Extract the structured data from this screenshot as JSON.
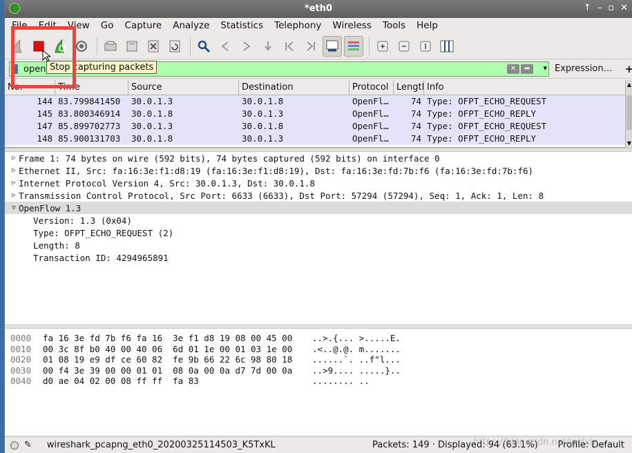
{
  "window": {
    "title": "*eth0",
    "controls": [
      "↑",
      "–",
      "▫",
      "✕"
    ]
  },
  "menu": [
    {
      "label": "File"
    },
    {
      "label": "Edit"
    },
    {
      "label": "View"
    },
    {
      "label": "Go"
    },
    {
      "label": "Capture"
    },
    {
      "label": "Analyze"
    },
    {
      "label": "Statistics"
    },
    {
      "label": "Telephony"
    },
    {
      "label": "Wireless"
    },
    {
      "label": "Tools"
    },
    {
      "label": "Help"
    }
  ],
  "toolbar": {
    "tooltip": "Stop capturing packets",
    "icons": [
      "shark-fin-icon",
      "stop-capture-icon",
      "restart-capture-icon",
      "capture-options-icon",
      "open-file-icon",
      "save-file-icon",
      "close-file-icon",
      "reload-icon",
      "find-packet-icon",
      "go-back-icon",
      "go-forward-icon",
      "go-to-packet-icon",
      "first-packet-icon",
      "last-packet-icon",
      "auto-scroll-icon",
      "colorize-icon",
      "zoom-in-icon",
      "zoom-out-icon",
      "normal-size-icon",
      "resize-columns-icon"
    ]
  },
  "filter": {
    "value": "openf",
    "expression_label": "Expression…",
    "add_label": "+",
    "color": "#afffaf"
  },
  "packet_list": {
    "columns": [
      "No.",
      "Time",
      "Source",
      "Destination",
      "Protocol",
      "Length",
      "Info"
    ],
    "rows": [
      {
        "no": "144",
        "time": "83.799841450",
        "src": "30.0.1.3",
        "dst": "30.0.1.8",
        "proto": "OpenFl…",
        "len": "74",
        "info": "Type: OFPT_ECHO_REQUEST"
      },
      {
        "no": "145",
        "time": "83.800346914",
        "src": "30.0.1.8",
        "dst": "30.0.1.3",
        "proto": "OpenFl…",
        "len": "74",
        "info": "Type: OFPT_ECHO_REPLY"
      },
      {
        "no": "147",
        "time": "85.899702773",
        "src": "30.0.1.3",
        "dst": "30.0.1.8",
        "proto": "OpenFl…",
        "len": "74",
        "info": "Type: OFPT_ECHO_REQUEST"
      },
      {
        "no": "148",
        "time": "85.900131703",
        "src": "30.0.1.8",
        "dst": "30.0.1.3",
        "proto": "OpenFl…",
        "len": "74",
        "info": "Type: OFPT_ECHO_REPLY"
      }
    ]
  },
  "details": {
    "rows": [
      {
        "text": "Frame 1: 74 bytes on wire (592 bits), 74 bytes captured (592 bits) on interface 0",
        "expanded": false
      },
      {
        "text": "Ethernet II, Src: fa:16:3e:f1:d8:19 (fa:16:3e:f1:d8:19), Dst: fa:16:3e:fd:7b:f6 (fa:16:3e:fd:7b:f6)",
        "expanded": false
      },
      {
        "text": "Internet Protocol Version 4, Src: 30.0.1.3, Dst: 30.0.1.8",
        "expanded": false
      },
      {
        "text": "Transmission Control Protocol, Src Port: 6633 (6633), Dst Port: 57294 (57294), Seq: 1, Ack: 1, Len: 8",
        "expanded": false
      },
      {
        "text": "OpenFlow 1.3",
        "expanded": true
      }
    ],
    "children": [
      "Version: 1.3 (0x04)",
      "Type: OFPT_ECHO_REQUEST (2)",
      "Length: 8",
      "Transaction ID: 4294965891"
    ]
  },
  "hex": [
    {
      "offset": "0000",
      "bytes": "fa 16 3e fd 7b f6 fa 16  3e f1 d8 19 08 00 45 00",
      "ascii": "..>.{... >.....E."
    },
    {
      "offset": "0010",
      "bytes": "00 3c 8f b0 40 00 40 06  6d 01 1e 00 01 03 1e 00",
      "ascii": ".<..@.@. m......."
    },
    {
      "offset": "0020",
      "bytes": "01 08 19 e9 df ce 60 82  fe 9b 66 22 6c 98 80 18",
      "ascii": "......`. ..f\"l..."
    },
    {
      "offset": "0030",
      "bytes": "00 f4 3e 39 00 00 01 01  08 0a 00 0a d7 7d 00 0a",
      "ascii": "..>9.... .....}.."
    },
    {
      "offset": "0040",
      "bytes": "d0 ae 04 02 00 08 ff ff  fa 83",
      "ascii": "........ .."
    }
  ],
  "status": {
    "filename": "wireshark_pcapng_eth0_20200325114503_K5TxKL",
    "packets": "Packets: 149 · Displayed: 94 (63.1%)",
    "profile": "Profile: Default",
    "watermark": "https://blog.csdn.net/weixin_..."
  }
}
